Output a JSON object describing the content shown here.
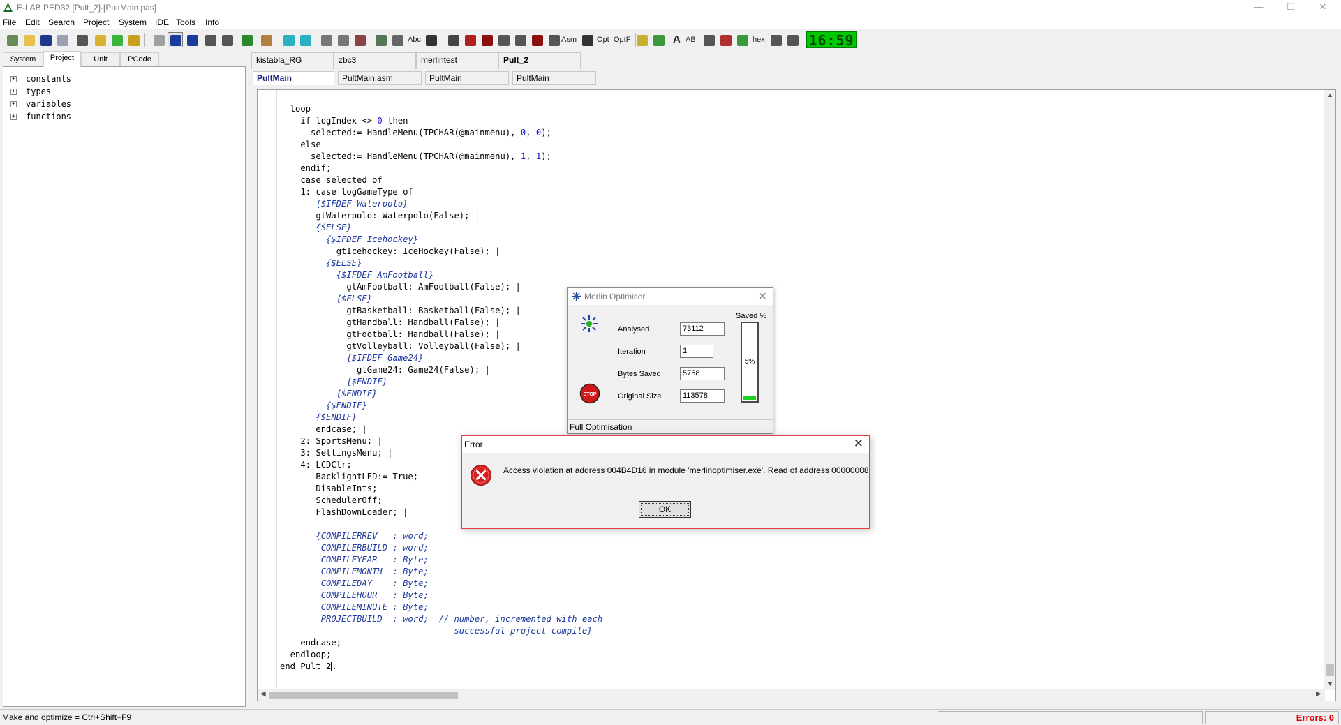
{
  "window": {
    "title": "E-LAB PED32 [Pult_2]-[PultMain.pas]"
  },
  "menu": [
    "File",
    "Edit",
    "Search",
    "Project",
    "System",
    "IDE",
    "Tools",
    "Info"
  ],
  "toolbar": {
    "text_buttons": [
      "Abc",
      "Asm",
      "Opt",
      "OptF",
      "A",
      "AB",
      "hex"
    ],
    "clock": "16:59"
  },
  "left_panel": {
    "tabs": [
      "System",
      "Project",
      "Unit",
      "PCode"
    ],
    "active_tab": "Project",
    "tree": [
      "constants",
      "types",
      "variables",
      "functions"
    ]
  },
  "file_tabs": [
    "kistabla_RG",
    "zbc3",
    "merlintest",
    "Pult_2"
  ],
  "active_file_tab": "Pult_2",
  "sub_tabs": [
    "PultMain",
    "PultMain.asm",
    "PultMain",
    "PultMain"
  ],
  "code_lines": [
    "  loop",
    "    if logIndex <> 0 then",
    "      selected:= HandleMenu(TPCHAR(@mainmenu), 0, 0);",
    "    else",
    "      selected:= HandleMenu(TPCHAR(@mainmenu), 1, 1);",
    "    endif;",
    "    case selected of",
    "    1: case logGameType of",
    "       {$IFDEF Waterpolo}",
    "       gtWaterpolo: Waterpolo(False); |",
    "       {$ELSE}",
    "         {$IFDEF Icehockey}",
    "           gtIcehockey: IceHockey(False); |",
    "         {$ELSE}",
    "           {$IFDEF AmFootball}",
    "             gtAmFootball: AmFootball(False); |",
    "           {$ELSE}",
    "             gtBasketball: Basketball(False); |",
    "             gtHandball: Handball(False); |",
    "             gtFootball: Handball(False); |",
    "             gtVolleyball: Volleyball(False); |",
    "             {$IFDEF Game24}",
    "               gtGame24: Game24(False); |",
    "             {$ENDIF}",
    "           {$ENDIF}",
    "         {$ENDIF}",
    "       {$ENDIF}",
    "       endcase; |",
    "    2: SportsMenu; |",
    "    3: SettingsMenu; |",
    "    4: LCDClr;",
    "       BacklightLED:= True;",
    "       DisableInts;",
    "       SchedulerOff;",
    "       FlashDownLoader; |",
    "",
    "       {COMPILERREV   : word;",
    "        COMPILERBUILD : word;",
    "        COMPILEYEAR   : Byte;",
    "        COMPILEMONTH  : Byte;",
    "        COMPILEDAY    : Byte;",
    "        COMPILEHOUR   : Byte;",
    "        COMPILEMINUTE : Byte;",
    "        PROJECTBUILD  : word;  // number, incremented with each",
    "                                  successful project compile}",
    "    endcase;",
    "  endloop;",
    "end Pult_2."
  ],
  "status": {
    "hint": "Make and optimize = Ctrl+Shift+F9",
    "errors": "Errors: 0"
  },
  "merlin": {
    "title": "Merlin Optimiser",
    "fields": [
      {
        "label": "Analysed",
        "value": "73112"
      },
      {
        "label": "Iteration",
        "value": "1"
      },
      {
        "label": "Bytes Saved",
        "value": "5758"
      },
      {
        "label": "Original Size",
        "value": "113578"
      }
    ],
    "saved_label": "Saved %",
    "saved_percent": 5,
    "saved_text": "5%",
    "status": "Full Optimisation",
    "stop_text": "STOP"
  },
  "error_dialog": {
    "title": "Error",
    "message": "Access violation at address 004B4D16 in module 'merlinoptimiser.exe'. Read of address 00000008",
    "ok_label": "OK"
  },
  "colors": {
    "clock_bg": "#00c800",
    "gauge_fill": "#22d022",
    "error_text": "#e00000",
    "comment": "#1f3aa0"
  }
}
